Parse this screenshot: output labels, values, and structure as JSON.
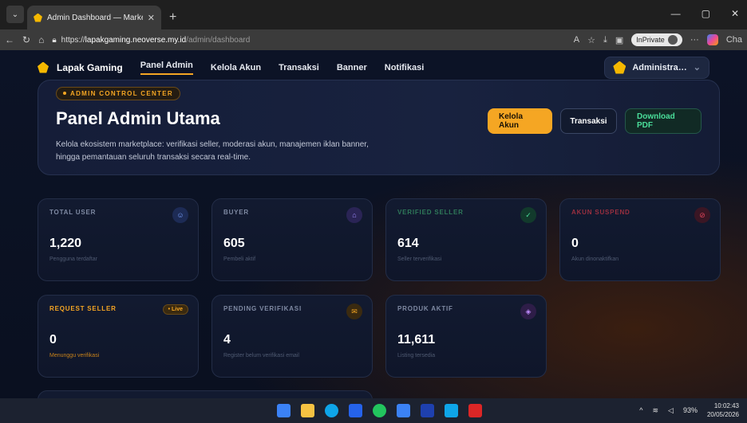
{
  "browser": {
    "tab_title": "Admin Dashboard — Marketplace",
    "tab_close": "✕",
    "new_tab": "+",
    "url_prefix": "https://",
    "url_domain": "lapakgaming.neoverse.my.id",
    "url_path": "/admin/dashboard",
    "inprivate_label": "InPrivate",
    "copilot_label": "Cha",
    "more": "···"
  },
  "nav": {
    "brand": "Lapak Gaming",
    "items": [
      {
        "label": "Panel Admin",
        "active": true
      },
      {
        "label": "Kelola Akun",
        "active": false
      },
      {
        "label": "Transaksi",
        "active": false
      },
      {
        "label": "Banner",
        "active": false
      },
      {
        "label": "Notifikasi",
        "active": false
      }
    ],
    "user_label": "Administra…"
  },
  "hero": {
    "badge": "ADMIN CONTROL CENTER",
    "title": "Panel Admin Utama",
    "description": "Kelola ekosistem marketplace: verifikasi seller, moderasi akun, manajemen iklan banner, hingga pemantauan seluruh transaksi secara real-time.",
    "buttons": {
      "primary": "Kelola Akun",
      "secondary": "Transaksi",
      "download": "Download PDF"
    }
  },
  "stats": [
    {
      "label": "TOTAL USER",
      "value": "1,220",
      "sub": "Pengguna terdaftar",
      "icon": "users-icon"
    },
    {
      "label": "BUYER",
      "value": "605",
      "sub": "Pembeli aktif",
      "icon": "bag-icon"
    },
    {
      "label": "VERIFIED SELLER",
      "value": "614",
      "sub": "Seller terverifikasi",
      "icon": "shield-check-icon"
    },
    {
      "label": "AKUN SUSPEND",
      "value": "0",
      "sub": "Akun dinonaktifkan",
      "icon": "ban-icon"
    },
    {
      "label": "REQUEST SELLER",
      "value": "0",
      "sub": "Menunggu verifikasi",
      "badge": "• Live"
    },
    {
      "label": "PENDING VERIFIKASI",
      "value": "4",
      "sub": "Register belum verifikasi email",
      "icon": "mail-icon"
    },
    {
      "label": "PRODUK AKTIF",
      "value": "11,611",
      "sub": "Listing tersedia",
      "icon": "box-icon"
    }
  ],
  "tray": {
    "battery": "93%",
    "time": "10:02:43",
    "date": "20/05/2026"
  },
  "colors": {
    "accent": "#f5a623",
    "green": "#4ade9a",
    "red": "#e0455a",
    "background": "#0a0f1e"
  }
}
